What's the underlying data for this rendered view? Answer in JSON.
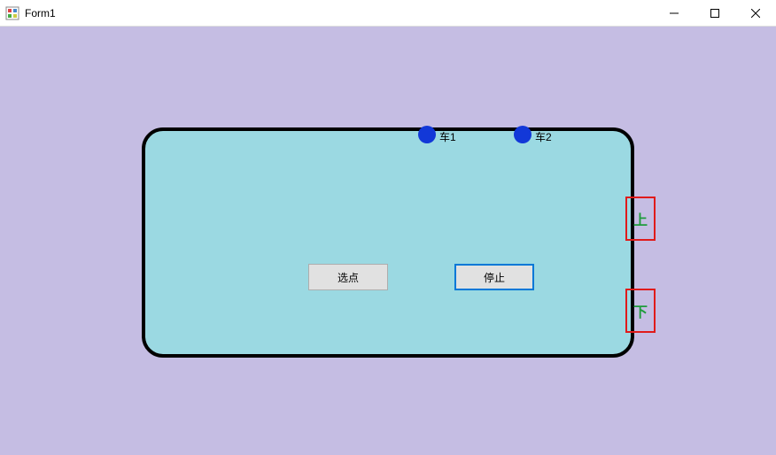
{
  "window": {
    "title": "Form1"
  },
  "cars": {
    "car1_label": "车1",
    "car2_label": "车2"
  },
  "buttons": {
    "select_label": "选点",
    "stop_label": "停止",
    "up_label": "上",
    "down_label": "下"
  }
}
